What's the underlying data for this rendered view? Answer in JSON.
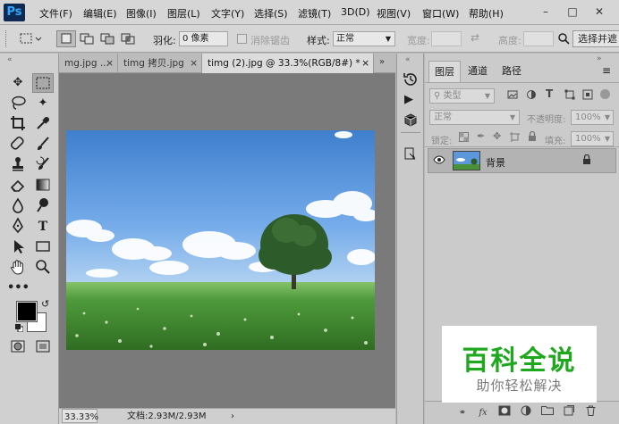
{
  "app": {
    "logo": "Ps"
  },
  "menu": [
    "文件(F)",
    "编辑(E)",
    "图像(I)",
    "图层(L)",
    "文字(Y)",
    "选择(S)",
    "滤镜(T)",
    "3D(D)",
    "视图(V)",
    "窗口(W)",
    "帮助(H)"
  ],
  "options": {
    "feather_label": "羽化:",
    "feather_value": "0 像素",
    "antialias_label": "消除锯齿",
    "style_label": "样式:",
    "style_value": "正常",
    "width_label": "宽度:",
    "height_label": "高度:",
    "select_mask": "选择并遮"
  },
  "tabs": [
    "mg.jpg ...",
    "timg 拷贝.jpg",
    "timg (2).jpg @ 33.3%(RGB/8#) *"
  ],
  "status": {
    "zoom": "33.33%",
    "doc": "文档:2.93M/2.93M"
  },
  "layers": {
    "tabs": [
      "图层",
      "通道",
      "路径"
    ],
    "filter_label": "类型",
    "blend_mode": "正常",
    "opacity_label": "不透明度:",
    "opacity_value": "100%",
    "lock_label": "锁定:",
    "fill_label": "填充:",
    "fill_value": "100%",
    "layer_name": "背景"
  },
  "watermark": {
    "title": "百科全说",
    "subtitle": "助你轻松解决",
    "color": "#1ea81e"
  }
}
